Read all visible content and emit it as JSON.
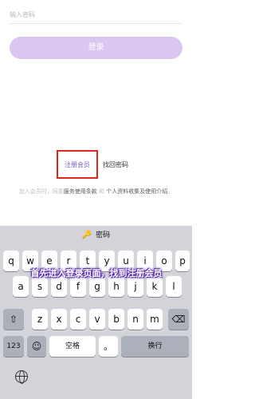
{
  "form": {
    "password_placeholder": "输入密码",
    "login_label": "登录"
  },
  "links": {
    "register_label": "注册会员",
    "forgot_label": "找回密码"
  },
  "terms": {
    "prefix": "加入会员时，同意",
    "service_terms": "服务使用条款",
    "and": "和",
    "privacy": "个人资料收集及使用介绍",
    "suffix": "。"
  },
  "keyboard": {
    "bar_label": "密码",
    "bar_icon": "key-icon",
    "row1": [
      "q",
      "w",
      "e",
      "r",
      "t",
      "y",
      "u",
      "i",
      "o",
      "p"
    ],
    "row2": [
      "a",
      "s",
      "d",
      "f",
      "g",
      "h",
      "j",
      "k",
      "l"
    ],
    "row3": [
      "z",
      "x",
      "c",
      "v",
      "b",
      "n",
      "m"
    ],
    "shift_icon": "⇧",
    "delete_icon": "⌫",
    "numbers_label": "123",
    "emoji_icon": "☺",
    "space_label": "空格",
    "period_label": "。",
    "return_label": "换行",
    "globe_icon": "globe-icon"
  },
  "overlay": {
    "caption": "首先进入登录页面，找到注册会员"
  },
  "colors": {
    "accent": "#7c5cc4",
    "login_button": "#d9c7f1",
    "highlight": "#e0251f",
    "keyboard_bg": "#d2d4d9"
  }
}
